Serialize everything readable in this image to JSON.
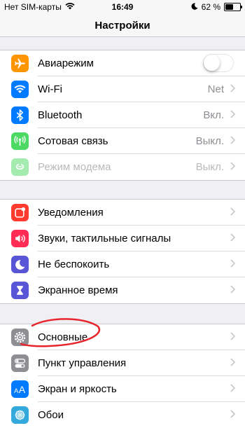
{
  "status_bar": {
    "carrier": "Нет SIM-карты",
    "time": "16:49",
    "battery": "62 %",
    "battery_level": 0.62
  },
  "nav": {
    "title": "Настройки"
  },
  "groups": [
    {
      "items": [
        {
          "label": "Авиарежим",
          "icon": "airplane-icon",
          "color": "#ff9500",
          "toggle": false
        },
        {
          "label": "Wi-Fi",
          "value": "Net",
          "icon": "wifi-icon",
          "color": "#007aff"
        },
        {
          "label": "Bluetooth",
          "value": "Вкл.",
          "icon": "bluetooth-icon",
          "color": "#007aff"
        },
        {
          "label": "Сотовая связь",
          "value": "Выкл.",
          "icon": "cellular-icon",
          "color": "#4cd964"
        },
        {
          "label": "Режим модема",
          "value": "Выкл.",
          "icon": "hotspot-icon",
          "color": "#4cd964",
          "disabled": true
        }
      ]
    },
    {
      "items": [
        {
          "label": "Уведомления",
          "icon": "notifications-icon",
          "color": "#ff3b30"
        },
        {
          "label": "Звуки, тактильные сигналы",
          "icon": "sound-icon",
          "color": "#ff2d55"
        },
        {
          "label": "Не беспокоить",
          "icon": "moon-icon",
          "color": "#5856d6"
        },
        {
          "label": "Экранное время",
          "icon": "hourglass-icon",
          "color": "#5856d6"
        }
      ]
    },
    {
      "items": [
        {
          "label": "Основные",
          "icon": "gear-icon",
          "color": "#8e8e93"
        },
        {
          "label": "Пункт управления",
          "icon": "switches-icon",
          "color": "#8e8e93"
        },
        {
          "label": "Экран и яркость",
          "icon": "text-size-icon",
          "color": "#007aff"
        },
        {
          "label": "Обои",
          "icon": "flower-icon",
          "color": "#34aadc"
        }
      ]
    }
  ]
}
